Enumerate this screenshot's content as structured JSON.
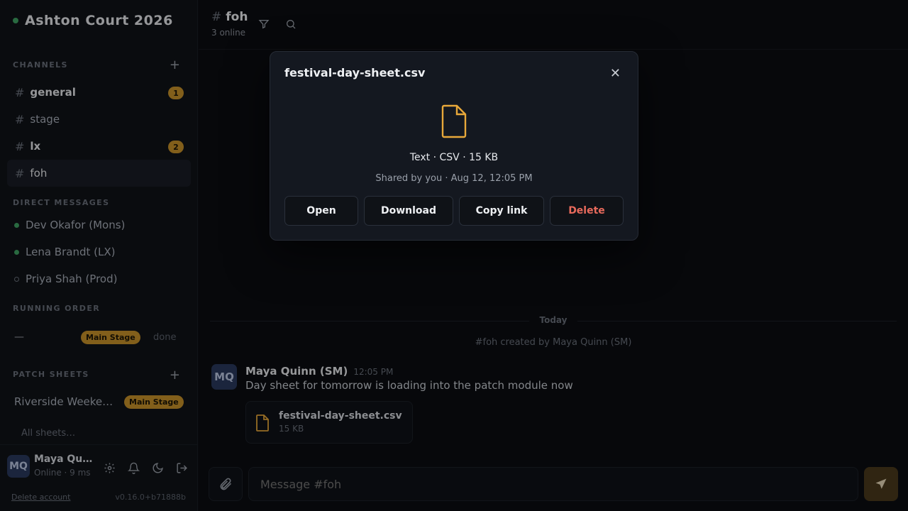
{
  "workspace": {
    "name": "Ashton Court 2026"
  },
  "sidebar": {
    "channels_label": "CHANNELS",
    "channels": [
      {
        "name": "general",
        "badge": "1",
        "bold": true
      },
      {
        "name": "stage",
        "badge": "",
        "bold": false
      },
      {
        "name": "lx",
        "badge": "2",
        "bold": true
      },
      {
        "name": "foh",
        "badge": "",
        "bold": false,
        "active": true
      }
    ],
    "dm_label": "DIRECT MESSAGES",
    "dms": [
      {
        "name": "Dev Okafor (Mons)",
        "online": true
      },
      {
        "name": "Lena Brandt (LX)",
        "online": true
      },
      {
        "name": "Priya Shah (Prod)",
        "online": false
      }
    ],
    "running_order_label": "RUNNING ORDER",
    "running_order": {
      "dash": "—",
      "stage": "Main Stage",
      "status": "done"
    },
    "patch_label": "PATCH SHEETS",
    "patch_sheets": [
      {
        "name": "Riverside Weeke…",
        "stage": "Main Stage"
      }
    ],
    "all_sheets": "All sheets…",
    "user": {
      "initials": "MQ",
      "name": "Maya Qu…",
      "status": "Online · 9 ms"
    },
    "delete_account": "Delete account",
    "version": "v0.16.0+b71888b"
  },
  "channel": {
    "hash": "#",
    "name": "foh",
    "online": "3 online"
  },
  "messages": {
    "divider": "Today",
    "created": "#foh created by Maya Quinn (SM)",
    "author_initials": "MQ",
    "author": "Maya Quinn (SM)",
    "time": "12:05 PM",
    "text": "Day sheet for tomorrow is loading into the patch module now",
    "attachment": {
      "name": "festival-day-sheet.csv",
      "size": "15 KB"
    }
  },
  "composer": {
    "placeholder": "Message #foh"
  },
  "modal": {
    "title": "festival-day-sheet.csv",
    "close": "✕",
    "meta": "Text · CSV · 15 KB",
    "shared": "Shared by you · Aug 12, 12:05 PM",
    "actions": {
      "open": "Open",
      "download": "Download",
      "copy": "Copy link",
      "delete": "Delete"
    }
  },
  "colors": {
    "accent": "#c8922a",
    "online": "#3fa463",
    "danger": "#e86a5c",
    "file_icon": "#e8a83a"
  }
}
